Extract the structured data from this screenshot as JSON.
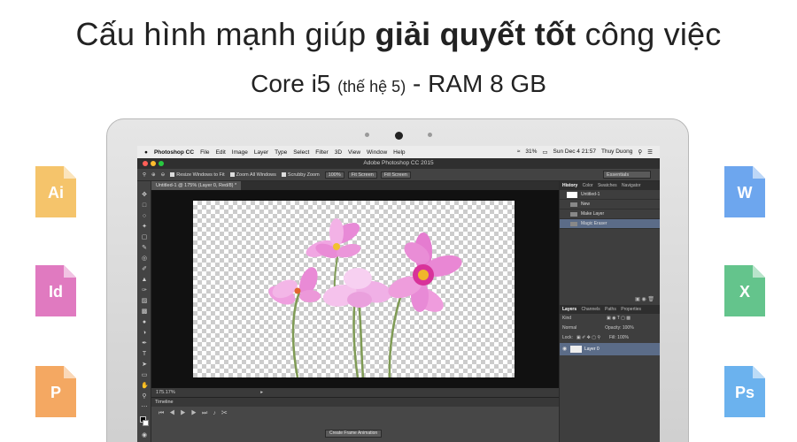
{
  "headline": {
    "pre": "Cấu hình mạnh giúp ",
    "bold": "giải quyết tốt",
    "post": " công việc"
  },
  "subline": {
    "main": "Core i5 ",
    "small": "(thế hệ 5)",
    "tail": " - RAM 8 GB"
  },
  "menubar": {
    "apple": "",
    "items": [
      "Photoshop CC",
      "File",
      "Edit",
      "Image",
      "Layer",
      "Type",
      "Select",
      "Filter",
      "3D",
      "View",
      "Window",
      "Help"
    ],
    "battery": "31%",
    "datetime": "Sun Dec 4  21:57",
    "user": "Thuy Duong"
  },
  "ps": {
    "title": "Adobe Photoshop CC 2015",
    "options": {
      "resize": "Resize Windows to Fit",
      "zoom_all": "Zoom All Windows",
      "scrubby": "Scrubby Zoom",
      "pct_button": "100%",
      "fit_screen": "Fit Screen",
      "fill_screen": "Fill Screen",
      "workspace": "Essentials"
    },
    "doc_tab": "Untitled-1 @ 175% (Layer 0, Red/8) *",
    "zoom_status": "175.17%",
    "timeline": {
      "label": "Timeline",
      "create_button": "Create Frame Animation"
    },
    "history": {
      "tabs": [
        "History",
        "Color",
        "Swatches",
        "Navigator"
      ],
      "rows": [
        "Untitled-1",
        "New",
        "Make Layer",
        "Magic Eraser"
      ]
    },
    "layers": {
      "tabs": [
        "Layers",
        "Channels",
        "Paths",
        "Properties"
      ],
      "kind": "Kind",
      "blend": "Normal",
      "opacity_label": "Opacity:",
      "opacity": "100%",
      "lock_label": "Lock:",
      "fill_label": "Fill:",
      "fill": "100%",
      "layer_name": "Layer 0"
    }
  },
  "file_icons": [
    {
      "label": "Ai",
      "color": "#f5c46b"
    },
    {
      "label": "Id",
      "color": "#e07ac0"
    },
    {
      "label": "P",
      "color": "#f4a862"
    },
    {
      "label": "W",
      "color": "#6da6ee"
    },
    {
      "label": "X",
      "color": "#64c48c"
    },
    {
      "label": "Ps",
      "color": "#6bb2ee"
    }
  ],
  "colors": {
    "flower": "#e87fd3",
    "flower_center": "#e0308e",
    "stem": "#7f9b55",
    "ps_selected": "#5b6c88"
  }
}
